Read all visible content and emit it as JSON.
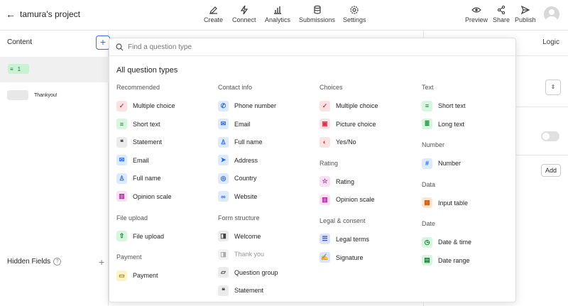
{
  "header": {
    "back_label": "tamura's project",
    "nav": [
      {
        "label": "Create",
        "icon": "pencil-icon"
      },
      {
        "label": "Connect",
        "icon": "bolt-icon"
      },
      {
        "label": "Analytics",
        "icon": "bar-chart-icon"
      },
      {
        "label": "Submissions",
        "icon": "database-icon"
      },
      {
        "label": "Settings",
        "icon": "gear-icon"
      }
    ],
    "actions": [
      {
        "label": "Preview",
        "icon": "eye-icon"
      },
      {
        "label": "Share",
        "icon": "share-icon"
      },
      {
        "label": "Publish",
        "icon": "send-icon"
      }
    ]
  },
  "sidebar": {
    "title": "Content",
    "add_symbol": "+",
    "question_number": "1",
    "ending_label": "Thankyou!",
    "hidden_fields_label": "Hidden Fields",
    "help_symbol": "?",
    "hidden_add_symbol": "+"
  },
  "right_panel": {
    "logic_label": "Logic",
    "add_label": "Add"
  },
  "popup": {
    "search_placeholder": "Find a question type",
    "title": "All question types",
    "columns": [
      {
        "groups": [
          {
            "title": "Recommended",
            "items": [
              {
                "label": "Multiple choice",
                "icon": "check-icon",
                "glyph": "✓",
                "bg": "#fde2e4",
                "fg": "#d6344a"
              },
              {
                "label": "Short text",
                "icon": "short-text-icon",
                "glyph": "≡",
                "bg": "#d8f5e0",
                "fg": "#1b7a34"
              },
              {
                "label": "Statement",
                "icon": "quote-icon",
                "glyph": "❝",
                "bg": "#ebebeb",
                "fg": "#444444"
              },
              {
                "label": "Email",
                "icon": "mail-icon",
                "glyph": "✉",
                "bg": "#dbeafe",
                "fg": "#2563eb"
              },
              {
                "label": "Full name",
                "icon": "person-icon",
                "glyph": "♙",
                "bg": "#dbeafe",
                "fg": "#2563eb"
              },
              {
                "label": "Opinion scale",
                "icon": "scale-icon",
                "glyph": "▥",
                "bg": "#fae0f4",
                "fg": "#b026a0"
              }
            ]
          },
          {
            "title": "File upload",
            "items": [
              {
                "label": "File upload",
                "icon": "upload-icon",
                "glyph": "⇧",
                "bg": "#d8f5e0",
                "fg": "#1b7a34"
              }
            ]
          },
          {
            "title": "Payment",
            "items": [
              {
                "label": "Payment",
                "icon": "credit-card-icon",
                "glyph": "▭",
                "bg": "#fdf3c7",
                "fg": "#a07a00"
              }
            ]
          }
        ]
      },
      {
        "groups": [
          {
            "title": "Contact info",
            "items": [
              {
                "label": "Phone number",
                "icon": "phone-icon",
                "glyph": "✆",
                "bg": "#dbeafe",
                "fg": "#2563eb"
              },
              {
                "label": "Email",
                "icon": "mail-icon",
                "glyph": "✉",
                "bg": "#dbeafe",
                "fg": "#2563eb"
              },
              {
                "label": "Full name",
                "icon": "person-icon",
                "glyph": "♙",
                "bg": "#dbeafe",
                "fg": "#2563eb"
              },
              {
                "label": "Address",
                "icon": "navigation-icon",
                "glyph": "➤",
                "bg": "#dbeafe",
                "fg": "#2563eb"
              },
              {
                "label": "Country",
                "icon": "globe-icon",
                "glyph": "◎",
                "bg": "#dbeafe",
                "fg": "#2563eb"
              },
              {
                "label": "Website",
                "icon": "link-icon",
                "glyph": "∞",
                "bg": "#dbeafe",
                "fg": "#2563eb"
              }
            ]
          },
          {
            "title": "Form structure",
            "items": [
              {
                "label": "Welcome",
                "icon": "door-icon",
                "glyph": "◨",
                "bg": "#ebebeb",
                "fg": "#444444",
                "dim": false
              },
              {
                "label": "Thank you",
                "icon": "door-icon",
                "glyph": "◨",
                "bg": "#f3f3f3",
                "fg": "#aaaaaa",
                "dim": true
              },
              {
                "label": "Question group",
                "icon": "folder-icon",
                "glyph": "▱",
                "bg": "#ebebeb",
                "fg": "#444444",
                "dim": false
              },
              {
                "label": "Statement",
                "icon": "quote-icon",
                "glyph": "❝",
                "bg": "#ebebeb",
                "fg": "#444444",
                "dim": false
              }
            ]
          }
        ]
      },
      {
        "groups": [
          {
            "title": "Choices",
            "items": [
              {
                "label": "Multiple choice",
                "icon": "check-icon",
                "glyph": "✓",
                "bg": "#fde2e4",
                "fg": "#d6344a"
              },
              {
                "label": "Picture choice",
                "icon": "image-icon",
                "glyph": "▣",
                "bg": "#fde2e4",
                "fg": "#d6344a"
              },
              {
                "label": "Yes/No",
                "icon": "yes-no-icon",
                "glyph": "◐",
                "bg": "#fde2e4",
                "fg": "#d6344a"
              }
            ]
          },
          {
            "title": "Rating",
            "items": [
              {
                "label": "Rating",
                "icon": "star-icon",
                "glyph": "☆",
                "bg": "#fae0f4",
                "fg": "#b026a0"
              },
              {
                "label": "Opinion scale",
                "icon": "scale-icon",
                "glyph": "▥",
                "bg": "#fae0f4",
                "fg": "#b026a0"
              }
            ]
          },
          {
            "title": "Legal & consent",
            "items": [
              {
                "label": "Legal terms",
                "icon": "document-icon",
                "glyph": "☰",
                "bg": "#dbe4fe",
                "fg": "#3b4fd6"
              },
              {
                "label": "Signature",
                "icon": "signature-icon",
                "glyph": "✍",
                "bg": "#dbe4fe",
                "fg": "#3b4fd6"
              }
            ]
          }
        ]
      },
      {
        "groups": [
          {
            "title": "Text",
            "items": [
              {
                "label": "Short text",
                "icon": "short-text-icon",
                "glyph": "≡",
                "bg": "#d8f5e0",
                "fg": "#1b7a34"
              },
              {
                "label": "Long text",
                "icon": "long-text-icon",
                "glyph": "≣",
                "bg": "#d8f5e0",
                "fg": "#1b7a34"
              }
            ]
          },
          {
            "title": "Number",
            "items": [
              {
                "label": "Number",
                "icon": "hash-icon",
                "glyph": "#",
                "bg": "#dbeafe",
                "fg": "#2563eb"
              }
            ]
          },
          {
            "title": "Data",
            "items": [
              {
                "label": "Input table",
                "icon": "table-icon",
                "glyph": "▦",
                "bg": "#fde8d8",
                "fg": "#d65a10"
              }
            ]
          },
          {
            "title": "Date",
            "items": [
              {
                "label": "Date & time",
                "icon": "clock-icon",
                "glyph": "◷",
                "bg": "#d8f5e0",
                "fg": "#1b7a34"
              },
              {
                "label": "Date range",
                "icon": "calendar-icon",
                "glyph": "▤",
                "bg": "#d8f5e0",
                "fg": "#1b7a34"
              }
            ]
          }
        ]
      }
    ]
  }
}
